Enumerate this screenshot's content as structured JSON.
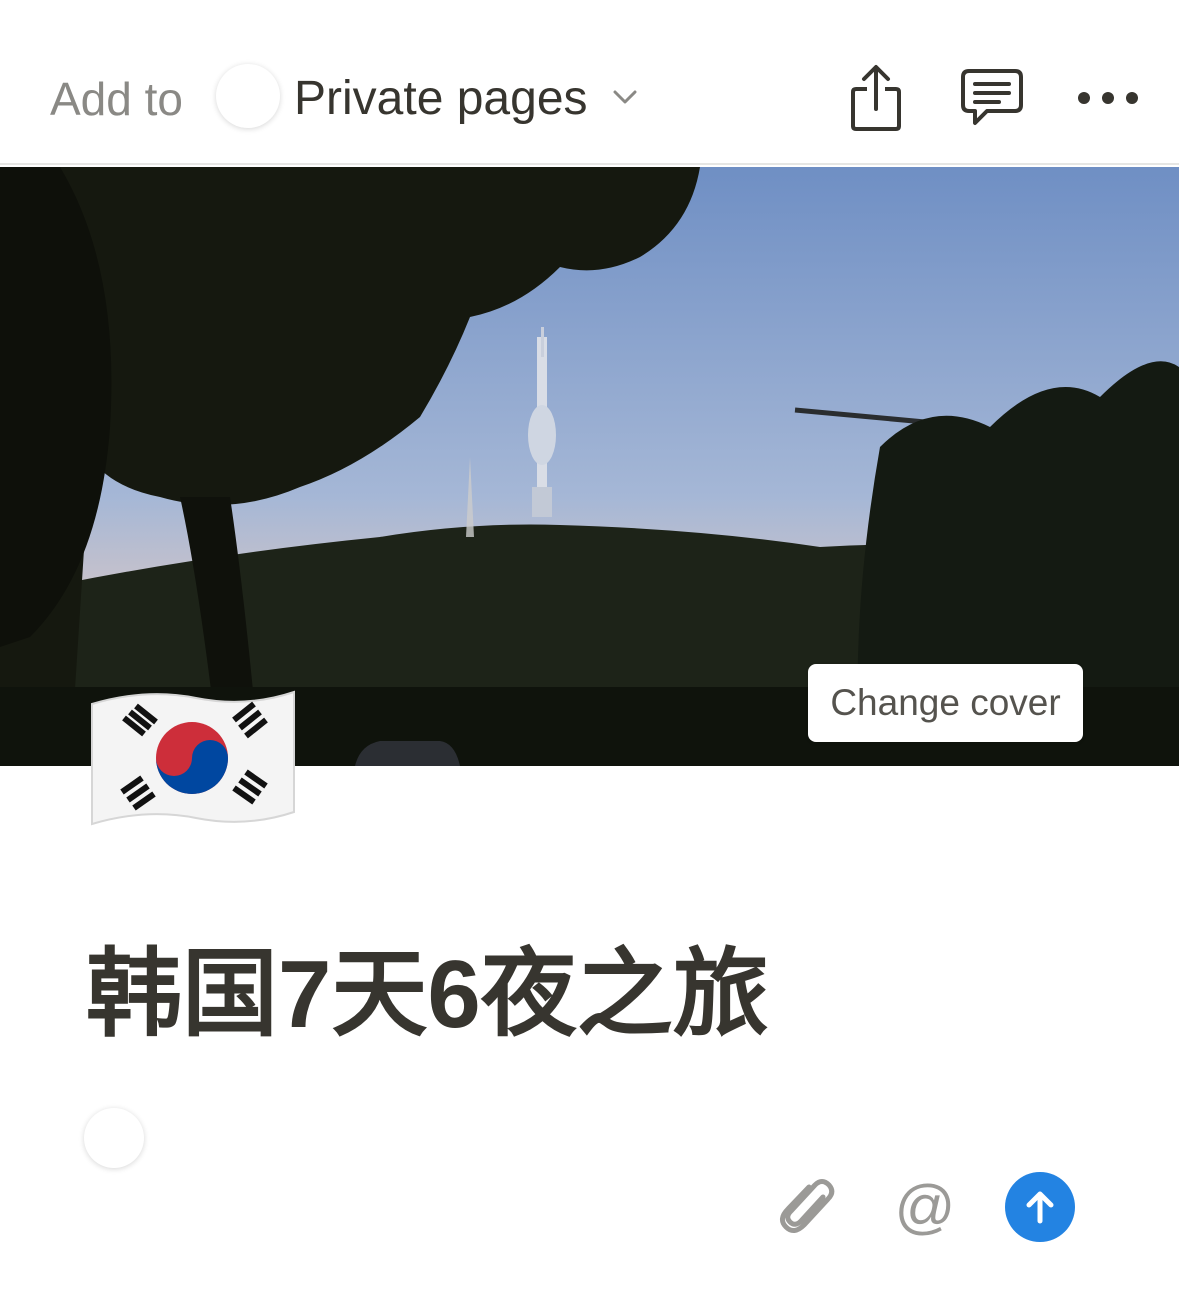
{
  "header": {
    "add_to_label": "Add to",
    "workspace_name": "Private pages",
    "icons": [
      "share-icon",
      "comment-icon",
      "more-icon",
      "chevron-down-icon"
    ]
  },
  "cover": {
    "change_cover_label": "Change cover"
  },
  "page": {
    "icon": "south-korea-flag",
    "title": "韩国7天6夜之旅"
  },
  "composer": {
    "mention_symbol": "@",
    "icons": [
      "attachment-icon",
      "mention-icon",
      "send-icon"
    ],
    "send_color": "#2383e2"
  }
}
